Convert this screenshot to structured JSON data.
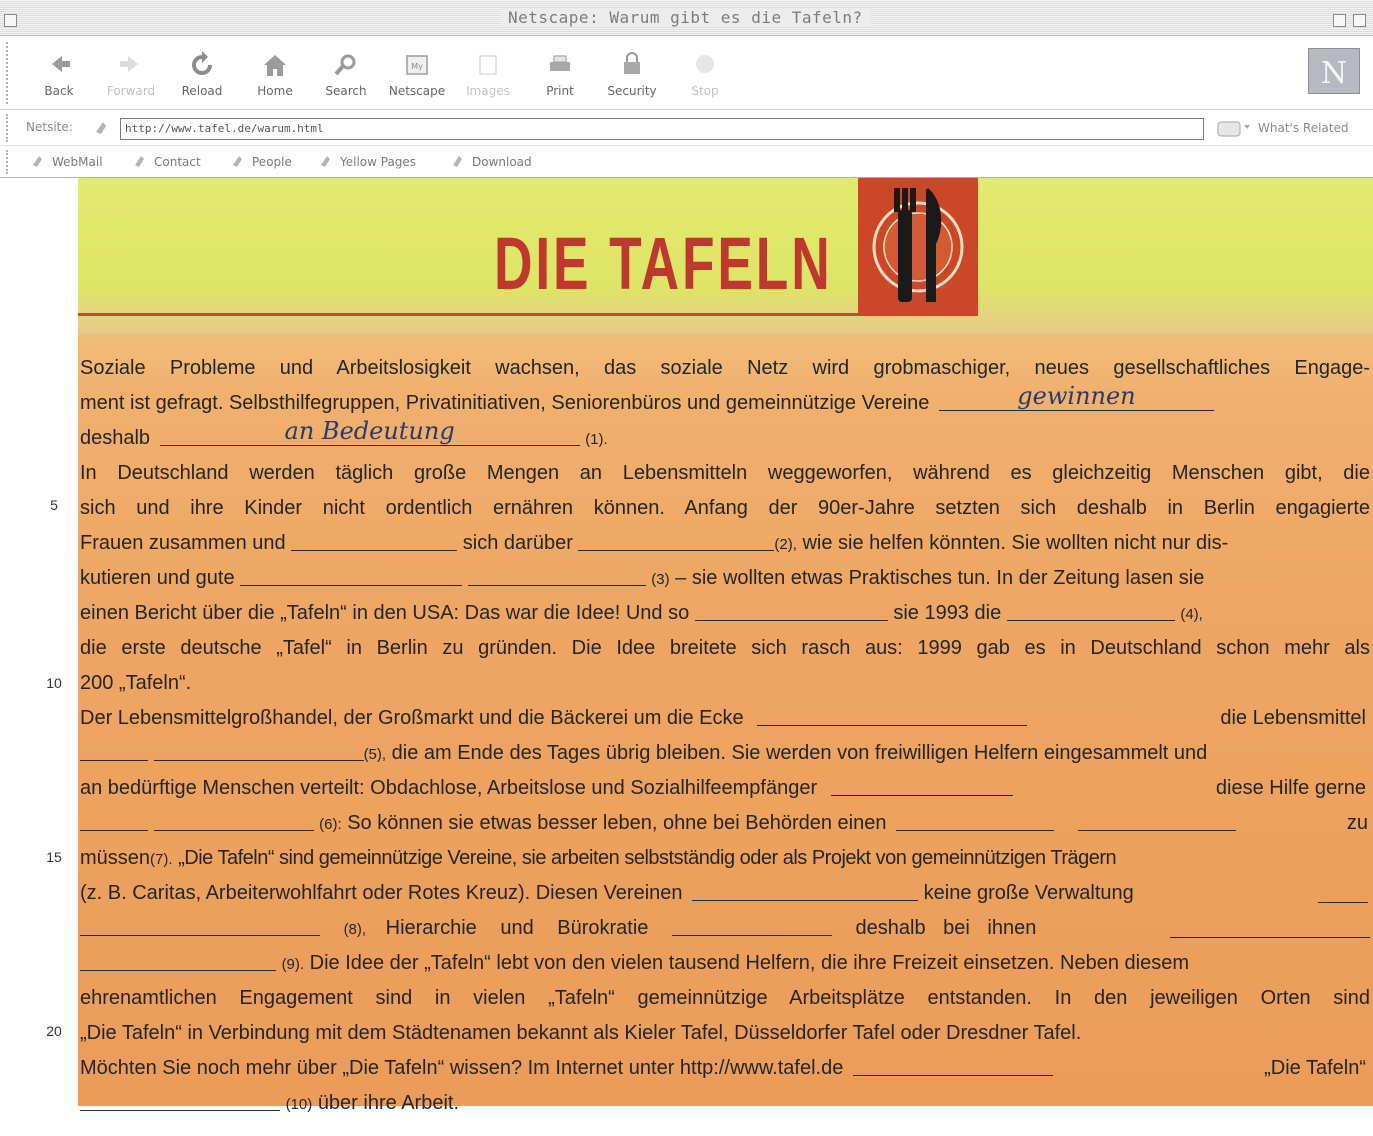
{
  "window": {
    "title": "Netscape: Warum gibt es die Tafeln?"
  },
  "toolbar": {
    "buttons": [
      {
        "label": "Back",
        "icon": "back-arrow-icon",
        "enabled": true
      },
      {
        "label": "Forward",
        "icon": "forward-arrow-icon",
        "enabled": false
      },
      {
        "label": "Reload",
        "icon": "reload-icon",
        "enabled": true
      },
      {
        "label": "Home",
        "icon": "home-icon",
        "enabled": true
      },
      {
        "label": "Search",
        "icon": "search-icon",
        "enabled": true
      },
      {
        "label": "Netscape",
        "icon": "my-netscape-icon",
        "enabled": true
      },
      {
        "label": "Images",
        "icon": "images-icon",
        "enabled": false
      },
      {
        "label": "Print",
        "icon": "print-icon",
        "enabled": true
      },
      {
        "label": "Security",
        "icon": "security-icon",
        "enabled": true
      },
      {
        "label": "Stop",
        "icon": "stop-icon",
        "enabled": false
      }
    ],
    "logo_letter": "N"
  },
  "location": {
    "label": "Netsite:",
    "url": "http://www.tafel.de/warum.html",
    "whats_related": "What's Related"
  },
  "personal_toolbar": [
    "WebMail",
    "Contact",
    "People",
    "Yellow Pages",
    "Download"
  ],
  "banner": {
    "title": "DIE TAFELN"
  },
  "article": {
    "lines": [
      {
        "text": "Soziale Probleme und Arbeitslosigkeit wachsen, das soziale Netz wird grobmaschiger, neues gesellschaftliches Engage-"
      },
      {
        "text": "ment ist gefragt. Selbsthilfegruppen, Privatinitiativen, Seniorenbüros und gemeinnützige Vereine"
      },
      {
        "text_a": "deshalb",
        "num": "(1)."
      },
      {
        "text": "In Deutschland werden täglich große Mengen an Lebensmitteln weggeworfen, während es gleichzeitig Menschen gibt, die"
      },
      {
        "text": "sich und ihre Kinder nicht ordentlich ernähren können. Anfang der 90er-Jahre setzten sich deshalb in Berlin engagierte"
      },
      {
        "text_a": "Frauen zusammen und",
        "text_b": "sich darüber",
        "num": "(2),",
        "text_c": "wie sie helfen könnten. Sie wollten nicht nur dis-"
      },
      {
        "text_a": "kutieren und gute",
        "num": "(3)",
        "text_c": "– sie wollten etwas Praktisches tun. In der Zeitung lasen sie"
      },
      {
        "text_a": "einen Bericht über die „Tafeln“ in den USA: Das war die Idee! Und so",
        "text_b": "sie 1993 die",
        "num": "(4),"
      },
      {
        "text": "die erste deutsche „Tafel“ in Berlin zu gründen. Die Idee breitete sich rasch aus: 1999 gab es in Deutschland schon mehr als"
      },
      {
        "text": "200 „Tafeln“."
      },
      {
        "text_a": "Der Lebensmittelgroßhandel, der Großmarkt und die Bäckerei um die Ecke",
        "text_b": "die Lebensmittel"
      },
      {
        "num": "(5),",
        "text_c": "die am Ende des Tages übrig bleiben. Sie werden von freiwilligen Helfern eingesammelt und"
      },
      {
        "text_a": "an bedürftige Menschen verteilt: Obdachlose, Arbeitslose und Sozialhilfeempfänger",
        "text_b": "diese Hilfe gerne"
      },
      {
        "num": "(6):",
        "text_c": "So können sie etwas besser leben, ohne bei Behörden einen",
        "text_d": "zu"
      },
      {
        "text_a": "müssen",
        "num": "(7).",
        "text_c": "„Die Tafeln“ sind gemeinnützige Vereine, sie arbeiten selbstständig oder als Projekt von gemeinnützigen Trägern"
      },
      {
        "text_a": "(z. B. Caritas, Arbeiterwohlfahrt oder Rotes Kreuz). Diesen Vereinen",
        "text_b": "keine große Verwaltung"
      },
      {
        "num": "(8),",
        "text_c": "Hierarchie und Bürokratie",
        "text_d": "deshalb bei ihnen"
      },
      {
        "num": "(9).",
        "text_c": "Die Idee der „Tafeln“ lebt von den vielen tausend Helfern, die ihre Freizeit einsetzen. Neben diesem"
      },
      {
        "text": "ehrenamtlichen Engagement sind in vielen „Tafeln“ gemeinnützige Arbeitsplätze entstanden. In den jeweiligen Orten sind"
      },
      {
        "text": "„Die Tafeln“ in Verbindung mit dem Städtenamen bekannt als Kieler Tafel, Düsseldorfer Tafel oder Dresdner Tafel."
      },
      {
        "text_a": "Möchten Sie noch mehr über „Die Tafeln“ wissen? Im Internet unter http://www.tafel.de",
        "text_b": "„Die Tafeln“"
      },
      {
        "num": "(10)",
        "text_c": "über ihre Arbeit."
      }
    ],
    "handwritten_answers": [
      "gewinnen",
      "an Bedeutung"
    ],
    "line_numbers": [
      "5",
      "10",
      "15",
      "20"
    ]
  },
  "colors": {
    "banner_yellow": "#dde566",
    "article_orange": "#eea563",
    "brand_red": "#c0372f"
  }
}
